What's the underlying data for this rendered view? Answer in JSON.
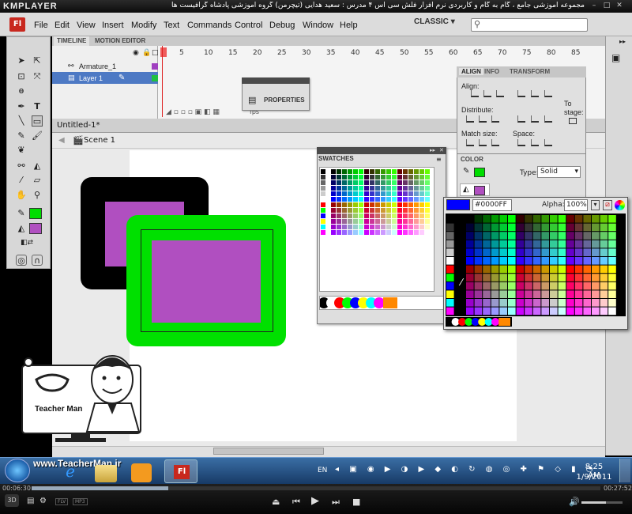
{
  "kmplayer": {
    "logo": "KMPLAYER",
    "title": "مجموعه آموزشی جامع ، گام به گام و کاربردی نرم افزار فلش سی اس ۴ مدرس : سعید هدایی (تیچرمن) گروه آموزشی پادشاه گرافیست ها",
    "time_elapsed": "00:06:30",
    "time_total": "00:27:52",
    "progress_fraction": 0.24,
    "volume_fraction": 0.6,
    "tags": [
      "FLV",
      "MP3",
      "3D"
    ]
  },
  "flash": {
    "logo": "Fl",
    "menu": [
      "File",
      "Edit",
      "View",
      "Insert",
      "Modify",
      "Text",
      "Commands",
      "Control",
      "Debug",
      "Window",
      "Help"
    ],
    "workspace": "CLASSIC",
    "search_placeholder": ""
  },
  "timeline": {
    "tabs": [
      "TIMELINE",
      "MOTION EDITOR"
    ],
    "layers": [
      "Armature_1",
      "Layer 1"
    ],
    "frame_numbers": [
      "5",
      "10",
      "15",
      "20",
      "25",
      "30",
      "35",
      "40",
      "45",
      "50",
      "55",
      "60",
      "65",
      "70",
      "75",
      "80",
      "85"
    ],
    "fps": "fps"
  },
  "properties_panel": {
    "label": "PROPERTIES"
  },
  "document": {
    "tab": "Untitled-1*",
    "scene": "Scene 1"
  },
  "swatches_panel": {
    "tab": "SWATCHES"
  },
  "align_panel": {
    "tabs": [
      "ALIGN",
      "INFO",
      "TRANSFORM"
    ],
    "align_label": "Align:",
    "distribute_label": "Distribute:",
    "match_size_label": "Match size:",
    "space_label": "Space:",
    "to_stage_label": "To stage:"
  },
  "color_panel": {
    "tab": "COLOR",
    "type_label": "Type:",
    "type_value": "Solid",
    "stroke_color": "#00dd00",
    "fill_color": "#b04fc0"
  },
  "color_picker": {
    "hex": "#0000FF",
    "alpha_label": "Alpha:",
    "alpha_value": "100%"
  },
  "canvas_colors": {
    "black_rect": "#000000",
    "green_rect": "#00e000",
    "purple_fill": "#b04fc0"
  },
  "teacher_man": {
    "url": "www.TeacherMan.ir",
    "text": "Teacher Man"
  },
  "taskbar": {
    "language": "EN",
    "time": "8:25 AM",
    "date": "1/9/2011"
  }
}
